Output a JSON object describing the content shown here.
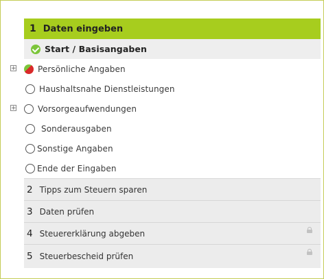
{
  "current_step": {
    "number": "1",
    "label": "Daten eingeben"
  },
  "substeps": [
    {
      "label": "Start / Basisangaben",
      "status": "complete",
      "expandable": false,
      "active": true
    },
    {
      "label": "Persönliche Angaben",
      "status": "partial",
      "expandable": true,
      "active": false
    },
    {
      "label": "Haushaltsnahe Dienstleistungen",
      "status": "empty",
      "expandable": false,
      "active": false
    },
    {
      "label": "Vorsorgeaufwendungen",
      "status": "empty",
      "expandable": true,
      "active": false
    },
    {
      "label": "Sonderausgaben",
      "status": "empty",
      "expandable": false,
      "active": false
    },
    {
      "label": "Sonstige Angaben",
      "status": "empty",
      "expandable": false,
      "active": false
    },
    {
      "label": "Ende der Eingaben",
      "status": "empty",
      "expandable": false,
      "active": false
    }
  ],
  "steps": [
    {
      "number": "2",
      "label": "Tipps zum Steuern sparen",
      "locked": false
    },
    {
      "number": "3",
      "label": "Daten prüfen",
      "locked": false
    },
    {
      "number": "4",
      "label": "Steuererklärung abgeben",
      "locked": true
    },
    {
      "number": "5",
      "label": "Steuerbescheid prüfen",
      "locked": true
    }
  ],
  "expander_symbol": "+",
  "colors": {
    "accent": "#a7cd1e",
    "complete": "#7cc53a",
    "error": "#d92a2a",
    "frame": "#c4cc55"
  }
}
